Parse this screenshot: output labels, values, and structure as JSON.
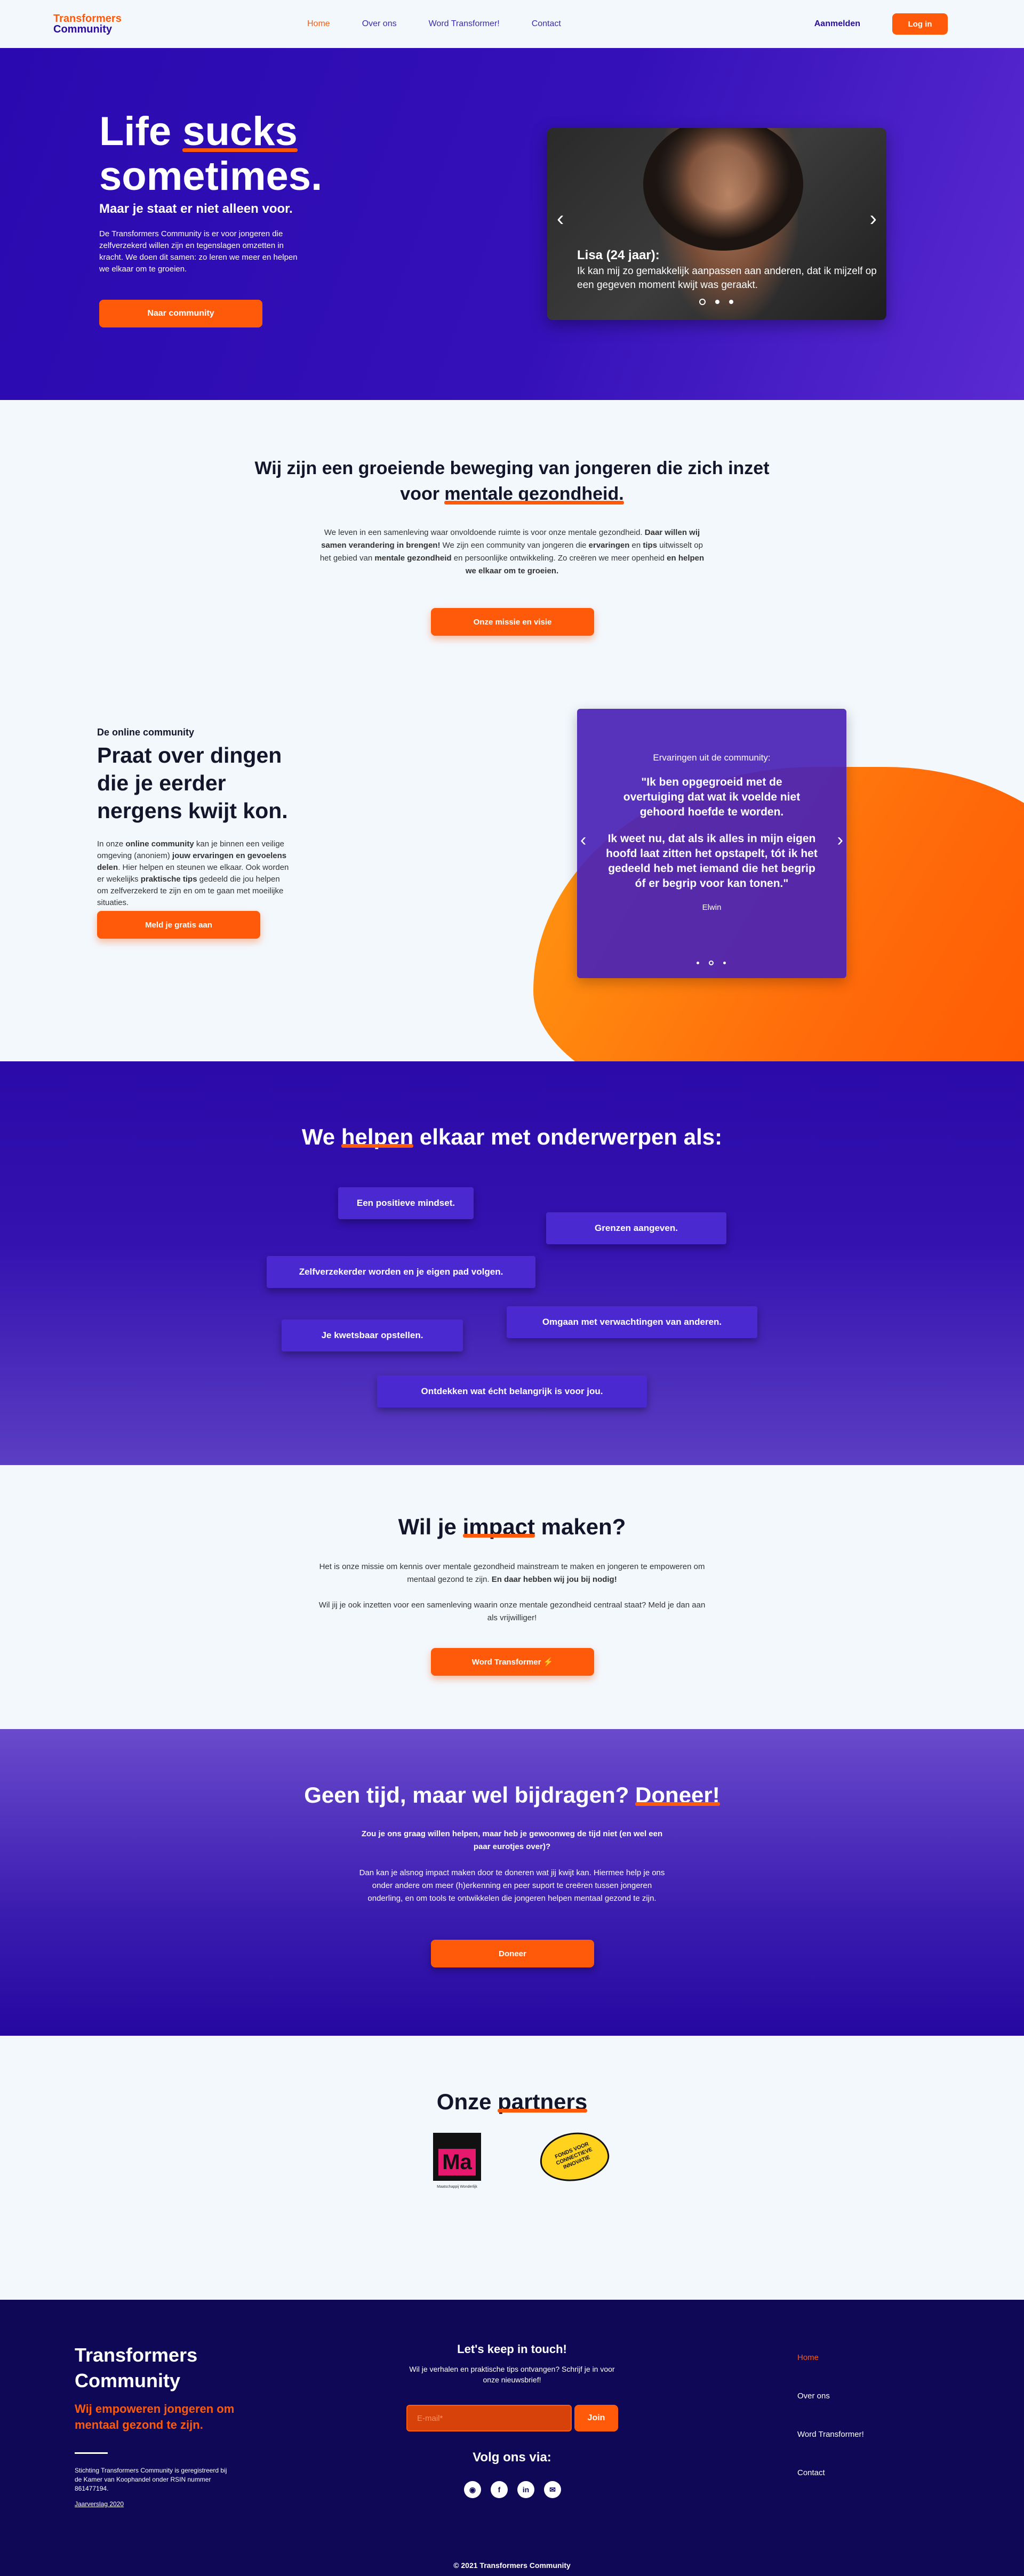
{
  "nav": {
    "logo_line1": "Transformers",
    "logo_line2": "Community",
    "links": [
      "Home",
      "Over ons",
      "Word Transformer!",
      "Contact"
    ],
    "signin": "Aanmelden",
    "login": "Log in"
  },
  "hero": {
    "title_a": "Life ",
    "title_b": "sucks",
    "title_c": "sometimes.",
    "subtitle": "Maar je staat er niet alleen voor.",
    "description": "De Transformers Community is er voor jongeren die zelfverzekerd willen zijn en tegenslagen omzetten in kracht. We doen dit samen: zo leren we meer en helpen we elkaar om te groeien.",
    "cta": "Naar community",
    "slide_name": "Lisa (24 jaar):",
    "slide_quote": "Ik kan mij zo gemakkelijk aanpassen aan anderen, dat ik mijzelf op een gegeven moment kwijt was geraakt."
  },
  "movement": {
    "title_a": "Wij zijn een groeiende beweging van jongeren die zich inzet voor ",
    "title_b": "mentale gezondheid.",
    "p_1": "We leven in een samenleving waar onvoldoende ruimte is voor onze mentale gezondheid. ",
    "p_2": "Daar willen wij samen verandering in brengen!",
    "p_3": " We zijn een community van jongeren die ",
    "p_4": "ervaringen",
    "p_5": " en ",
    "p_6": "tips",
    "p_7": " uitwisselt op het gebied van ",
    "p_8": "mentale gezondheid",
    "p_9": " en persoonlijke ontwikkeling. Zo creëren we meer openheid ",
    "p_10": "en helpen we elkaar om te groeien.",
    "cta": "Onze missie en visie"
  },
  "online": {
    "kicker": "De online community",
    "title": "Praat over dingen die je eerder nergens kwijt kon.",
    "p_1": "In onze ",
    "p_2": "online community",
    "p_3": " kan je binnen een veilige omgeving (anoniem) ",
    "p_4": "jouw ervaringen en gevoelens delen",
    "p_5": ". Hier helpen en steunen we elkaar. Ook worden er wekelijks ",
    "p_6": "praktische tips",
    "p_7": " gedeeld die jou helpen om zelfverzekerd te zijn en om te gaan met moeilijke situaties.",
    "cta": "Meld je gratis aan",
    "exp_title": "Ervaringen uit de community:",
    "exp_quote1": "\"Ik ben opgegroeid met de overtuiging dat wat ik voelde niet gehoord hoefde te worden.",
    "exp_quote2": "Ik weet nu, dat als ik alles in mijn eigen hoofd laat zitten het opstapelt, tót ik het gedeeld heb met iemand die het begrip óf er begrip voor kan tonen.\"",
    "exp_who": "Elwin"
  },
  "topics": {
    "title_a": "We ",
    "title_b": "helpen",
    "title_c": " elkaar met onderwerpen als:",
    "chips": [
      "Een positieve mindset.",
      "Grenzen aangeven.",
      "Zelfverzekerder worden en je eigen pad volgen.",
      "Omgaan met verwachtingen van anderen.",
      "Je kwetsbaar opstellen.",
      "Ontdekken wat écht belangrijk is voor jou."
    ]
  },
  "impact": {
    "title_a": "Wil je ",
    "title_b": "impact",
    "title_c": " maken?",
    "p1_a": "Het is onze missie om kennis over mentale gezondheid mainstream te maken en jongeren te empoweren om mentaal gezond te zijn. ",
    "p1_b": "En daar hebben wij jou bij nodig!",
    "p2": "Wil jij je ook inzetten voor een samenleving waarin onze mentale gezondheid centraal staat? Meld je dan aan als vrijwilliger!",
    "cta": "Word Transformer ⚡"
  },
  "donate": {
    "title_a": "Geen tijd, maar wel bijdragen? ",
    "title_b": "Doneer!",
    "p1": "Zou je ons graag willen helpen, maar heb je gewoonweg de tijd niet (en wel een paar eurotjes over)?",
    "p2": "Dan kan je alsnog impact maken door te doneren wat jij kwijt kan. Hiermee help je ons onder andere om meer (h)erkenning en peer suport te creëren tussen jongeren onderling, en om tools te ontwikkelen die jongeren helpen mentaal gezond te zijn.",
    "cta": "Doneer"
  },
  "partners": {
    "title_a": "Onze ",
    "title_b": "partners",
    "p1_mark": "Ma",
    "p1_caption": "Maatschappij Wonderlijk",
    "p2_text": "FONDS VOOR CONNECTIEVE INNOVATIE"
  },
  "footer": {
    "brand": "Transformers Community",
    "tagline": "Wij empoweren jongeren om mentaal gezond te zijn.",
    "legal": "Stichting Transformers Community is geregistreerd bij de Kamer van Koophandel onder RSIN nummer 861477194.",
    "report": "Jaarverslag 2020",
    "nl_title": "Let's keep in touch!",
    "nl_text": "Wil je verhalen en praktische tips ontvangen? Schrijf je in voor onze nieuwsbrief!",
    "email_placeholder": "E-mail*",
    "join": "Join",
    "follow": "Volg ons via:",
    "links": [
      "Home",
      "Over ons",
      "Word Transformer!",
      "Contact"
    ],
    "copyright": "© 2021 Transformers Community"
  }
}
